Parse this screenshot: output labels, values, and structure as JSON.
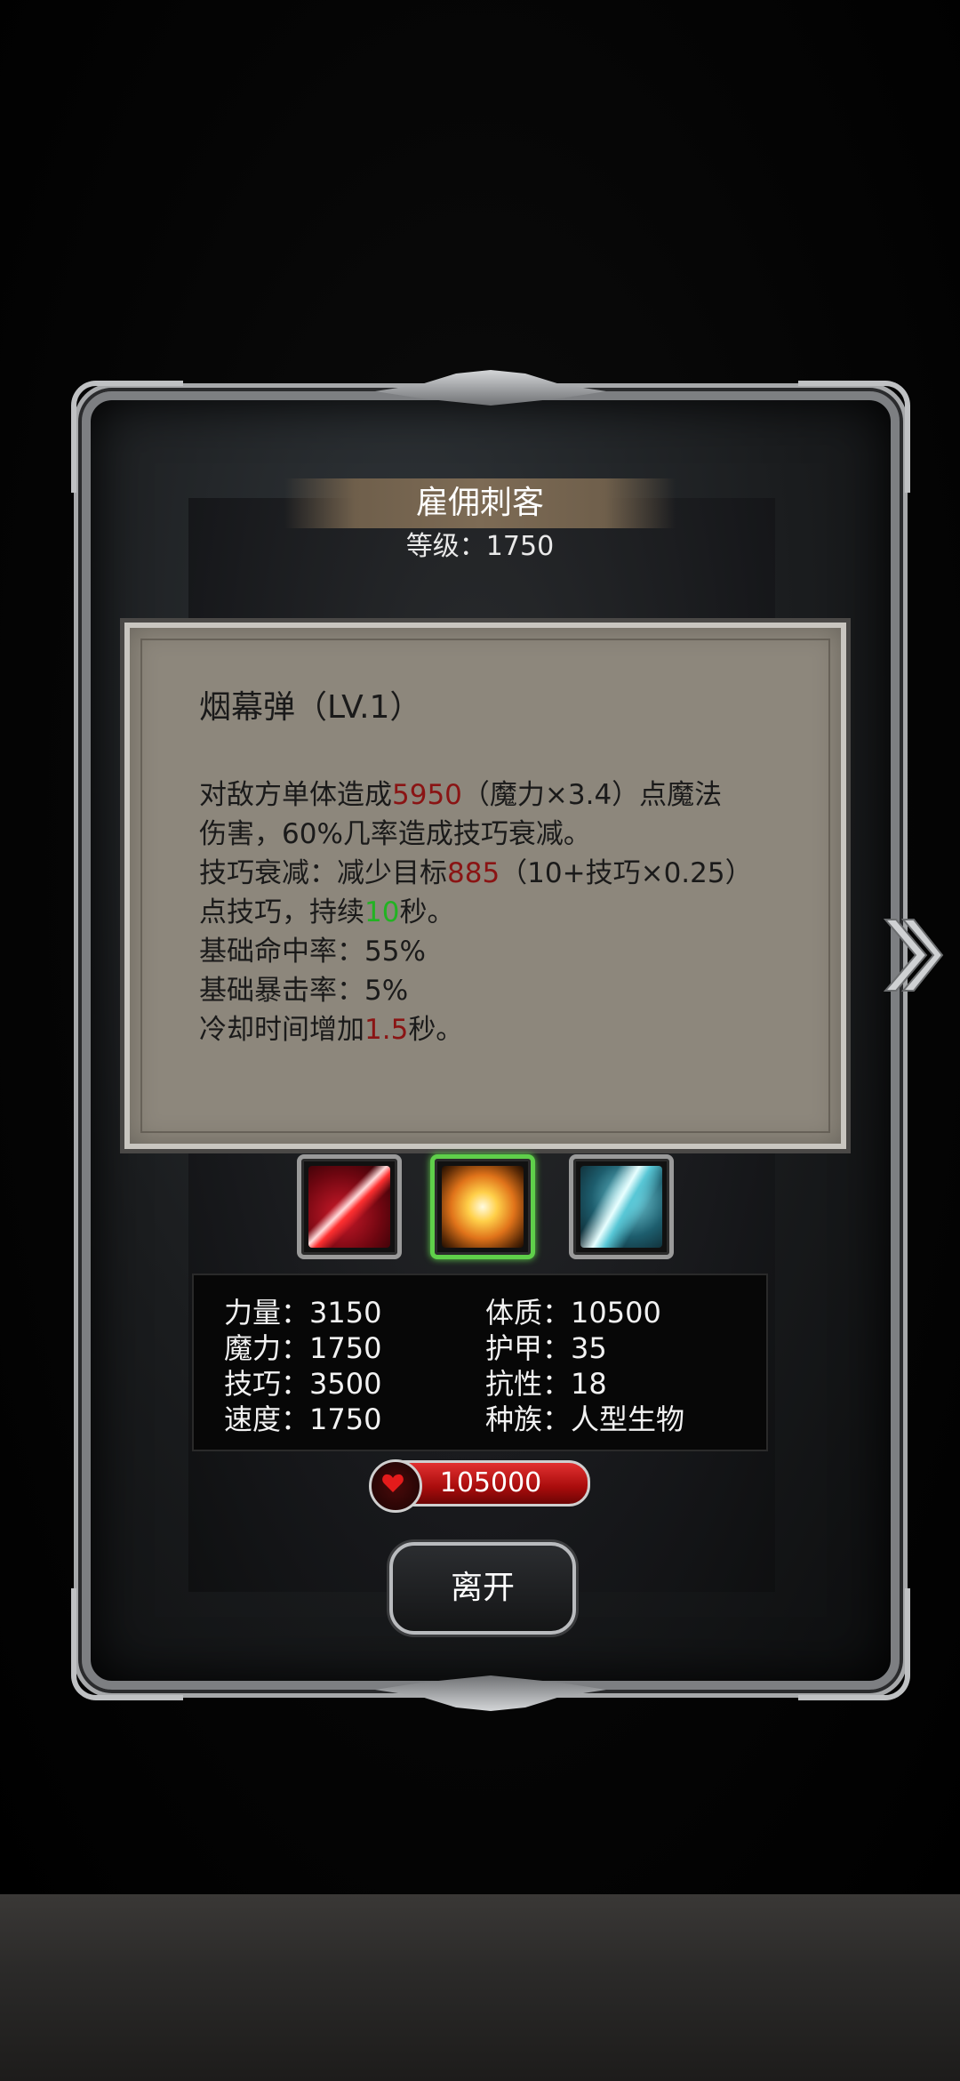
{
  "unit": {
    "name": "雇佣刺客",
    "level_text": "等级：1750"
  },
  "skill": {
    "title": "烟幕弹（LV.1）",
    "desc": {
      "l1_a": "对敌方单体造成",
      "l1_dmg": "5950",
      "l1_b": "（魔力×3.4）点魔法",
      "l2": "伤害，60%几率造成技巧衰减。",
      "l3_a": "技巧衰减：减少目标",
      "l3_val": "885",
      "l3_b": "（10+技巧×0.25）",
      "l4_a": "点技巧，持续",
      "l4_dur": "10",
      "l4_b": "秒。",
      "l5": "基础命中率：55%",
      "l6": "基础暴击率：5%",
      "l7_a": "冷却时间增加",
      "l7_val": "1.5",
      "l7_b": "秒。"
    }
  },
  "skill_icons": [
    {
      "name": "red-slash-skill-icon",
      "selected": false
    },
    {
      "name": "smoke-bomb-skill-icon",
      "selected": true
    },
    {
      "name": "cyan-slash-skill-icon",
      "selected": false
    }
  ],
  "stats": {
    "strength": "力量：3150",
    "magic": "魔力：1750",
    "skill": "技巧：3500",
    "speed": "速度：1750",
    "constitution": "体质：10500",
    "armor": "护甲：35",
    "resistance": "抗性：18",
    "race": "种族：人型生物"
  },
  "hp": "105000",
  "buttons": {
    "leave": "离开"
  },
  "colors": {
    "damage_red": "#8a1414",
    "duration_green": "#22b322",
    "selected_border": "#5fcf4a"
  }
}
